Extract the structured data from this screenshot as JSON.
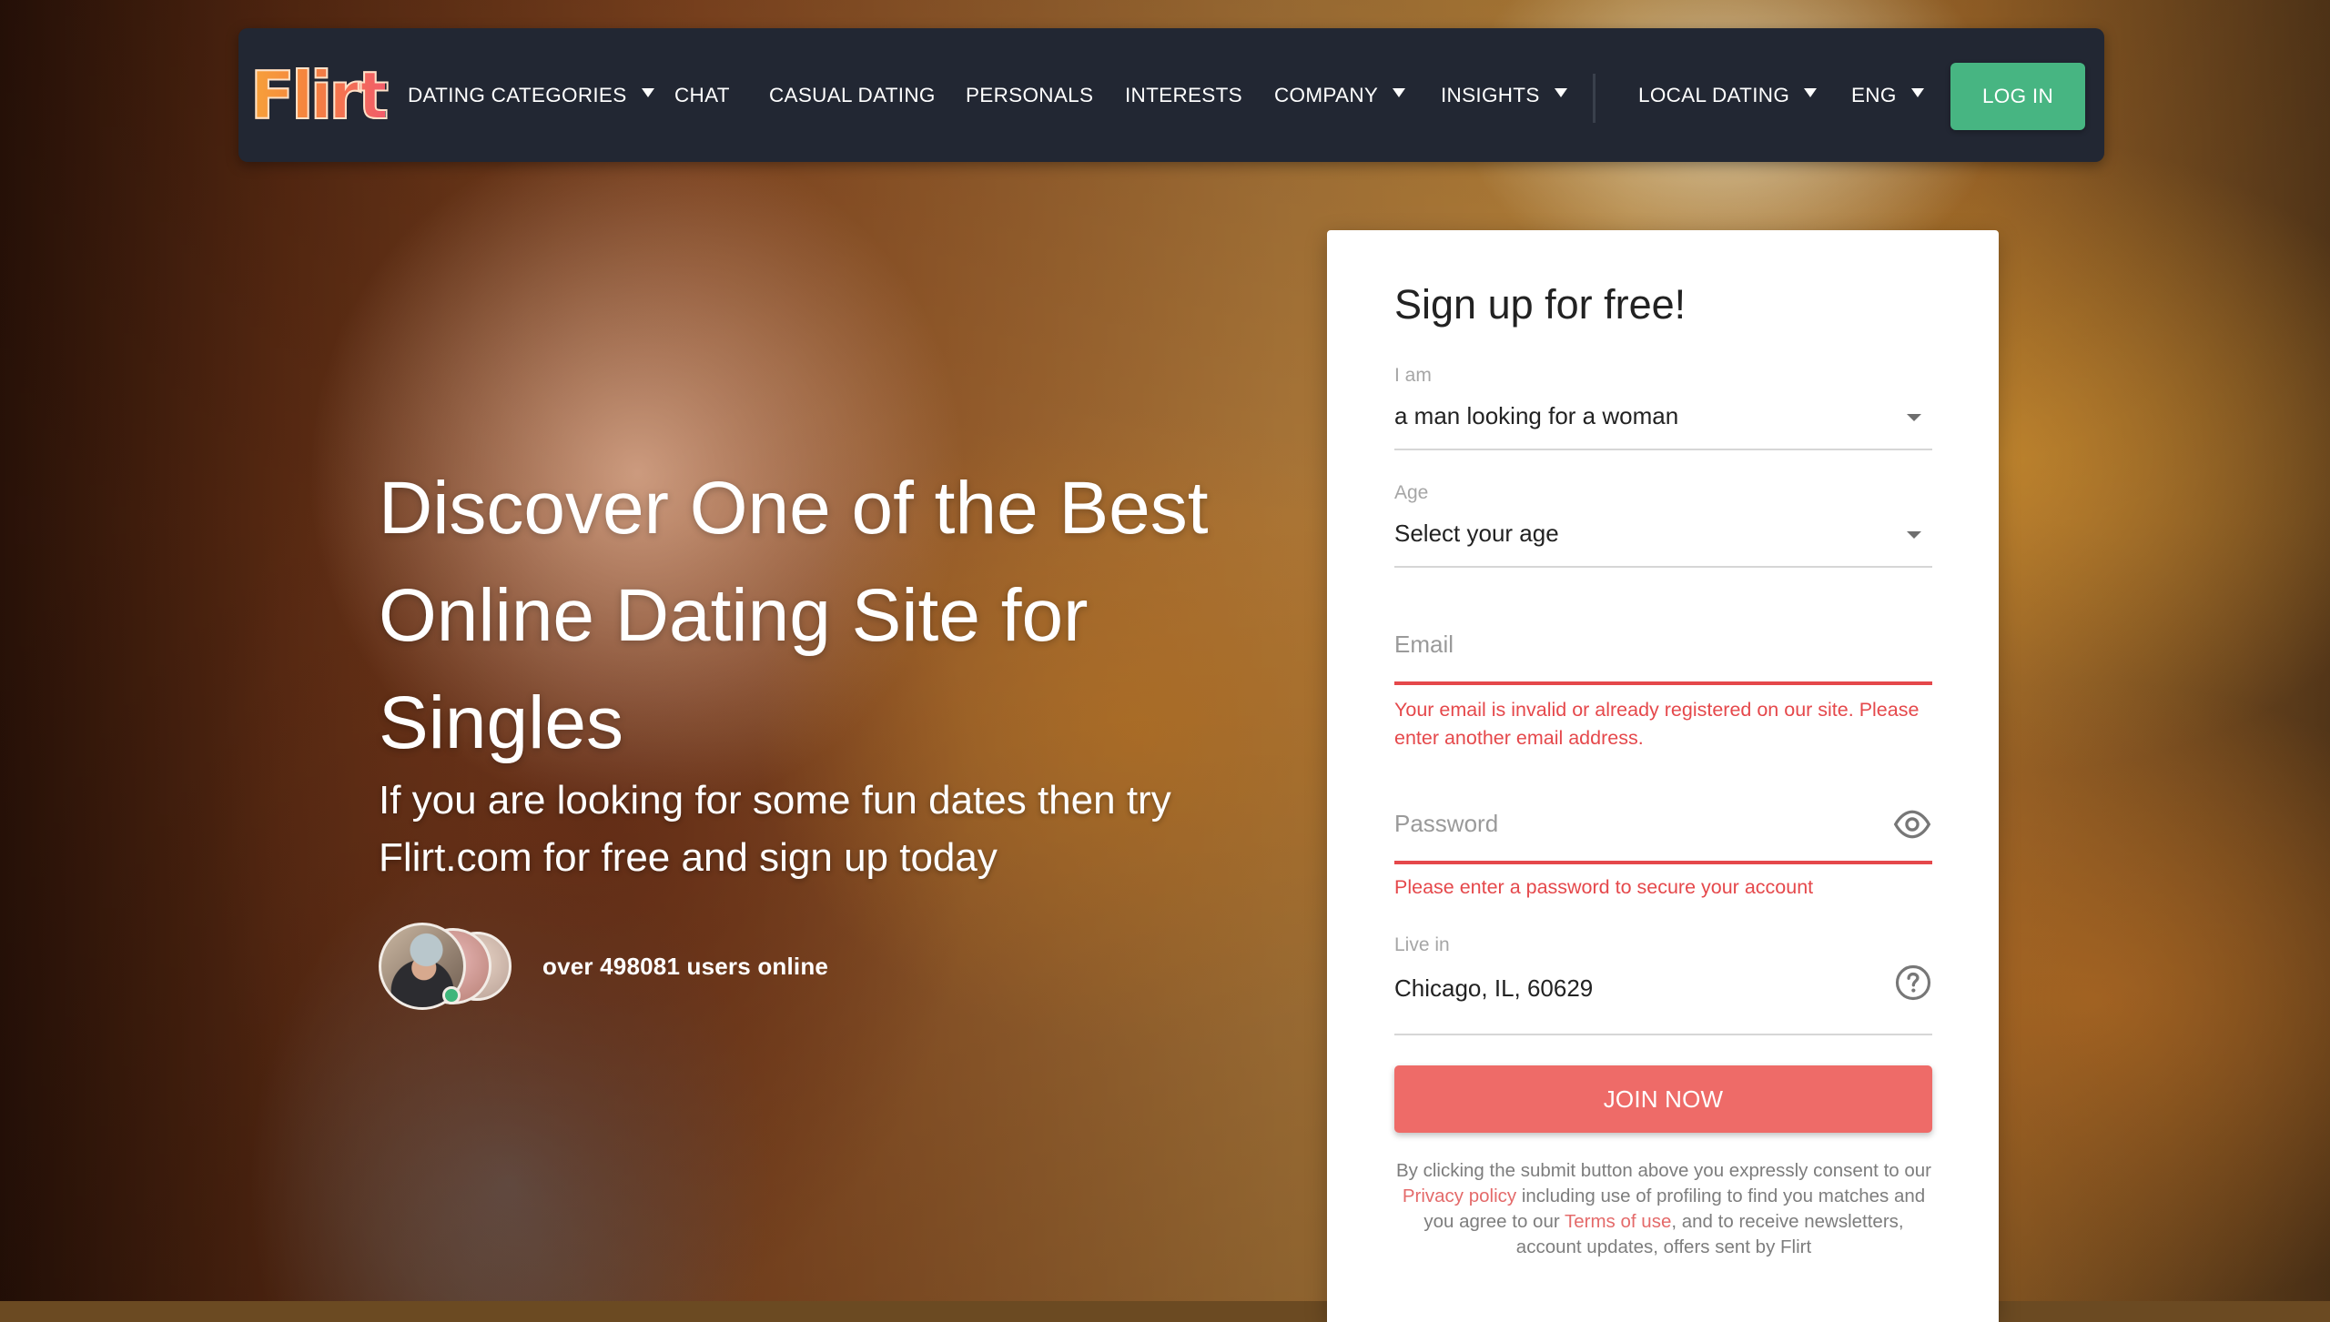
{
  "navbar": {
    "logo_text": "Flirt",
    "items": [
      {
        "label": "DATING CATEGORIES",
        "has_dropdown": true
      },
      {
        "label": "CHAT",
        "has_dropdown": false
      },
      {
        "label": "CASUAL DATING",
        "has_dropdown": false
      },
      {
        "label": "PERSONALS",
        "has_dropdown": false
      },
      {
        "label": "INTERESTS",
        "has_dropdown": false
      },
      {
        "label": "COMPANY",
        "has_dropdown": true
      },
      {
        "label": "INSIGHTS",
        "has_dropdown": true
      },
      {
        "label": "LOCAL DATING",
        "has_dropdown": true
      },
      {
        "label": "ENG",
        "has_dropdown": true
      }
    ],
    "login_label": "LOG IN"
  },
  "hero": {
    "title": "Discover One of the Best Online Dating Site for Singles",
    "subtitle": "If you are looking for some fun dates then try Flirt.com for free and sign up today",
    "online_text": "over 498081 users online"
  },
  "signup": {
    "title": "Sign up for free!",
    "i_am": {
      "label": "I am",
      "value": "a man looking for a woman"
    },
    "age": {
      "label": "Age",
      "value": "Select your age"
    },
    "email": {
      "placeholder": "Email",
      "value": "",
      "error": "Your email is invalid or already registered on our site. Please enter another email address."
    },
    "password": {
      "placeholder": "Password",
      "value": "",
      "error": "Please enter a password to secure your account"
    },
    "live_in": {
      "label": "Live in",
      "value": "Chicago, IL, 60629"
    },
    "join_label": "JOIN NOW",
    "consent": {
      "part1": "By clicking the submit button above you expressly consent to our ",
      "privacy_link": "Privacy policy",
      "part2": " including use of profiling to find you matches and you agree to our ",
      "terms_link": "Terms of use",
      "part3": ", and to receive newsletters, account updates, offers sent by Flirt"
    }
  },
  "colors": {
    "navbar_bg": "#222733",
    "login_green": "#47b582",
    "join_red": "#ee6b68",
    "error_red": "#e5484b",
    "link_red": "#e46a6a",
    "online_green": "#3fb67b"
  }
}
